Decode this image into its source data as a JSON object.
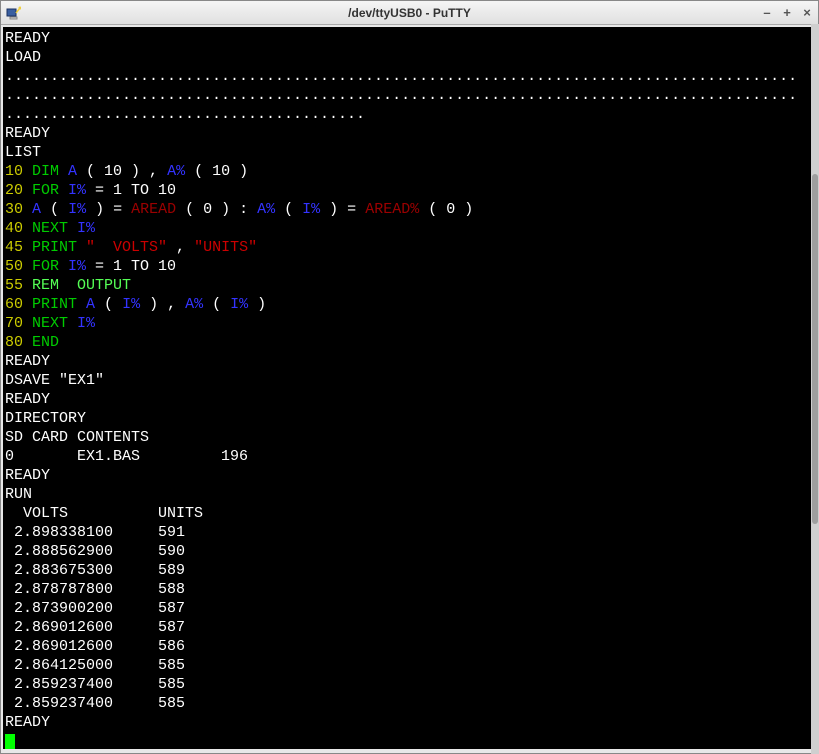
{
  "titlebar": {
    "title": "/dev/ttyUSB0 - PuTTY",
    "minimize": "–",
    "maximize": "+",
    "close": "×"
  },
  "terminal": {
    "ready1": "READY",
    "load": "LOAD",
    "dots1": "........................................................................................",
    "dots2": "........................................................................................",
    "dots3": "........................................",
    "blank": " ",
    "ready2": "READY",
    "list": "LIST",
    "l10_num": "10",
    "l10_dim": " DIM ",
    "l10_A": "A",
    "l10_p1": " ( 10 ) , ",
    "l10_Apct": "A%",
    "l10_p2": " ( 10 )",
    "l20_num": "20",
    "l20_for": " FOR ",
    "l20_Ipct": "I%",
    "l20_rest": " = 1 TO 10",
    "l30_num": "30",
    "l30_sp": " ",
    "l30_A": "A",
    "l30_p1": " ( ",
    "l30_Ipct1": "I%",
    "l30_p2": " ) = ",
    "l30_aread": "AREAD",
    "l30_p3": " ( 0 ) : ",
    "l30_Apct": "A%",
    "l30_p4": " ( ",
    "l30_Ipct2": "I%",
    "l30_p5": " ) = ",
    "l30_areadpct": "AREAD%",
    "l30_p6": " ( 0 )",
    "l40_num": "40",
    "l40_next": " NEXT ",
    "l40_Ipct": "I%",
    "l45_num": "45",
    "l45_print": " PRINT ",
    "l45_volts": "\"  VOLTS\"",
    "l45_comma": " , ",
    "l45_units": "\"UNITS\"",
    "l50_num": "50",
    "l50_for": " FOR ",
    "l50_Ipct": "I%",
    "l50_rest": " = 1 TO 10",
    "l55_num": "55",
    "l55_rem": " REM  OUTPUT",
    "l60_num": "60",
    "l60_print": " PRINT ",
    "l60_A": "A",
    "l60_p1": " ( ",
    "l60_Ipct1": "I%",
    "l60_p2": " ) , ",
    "l60_Apct": "A%",
    "l60_p3": " ( ",
    "l60_Ipct2": "I%",
    "l60_p4": " )",
    "l70_num": "70",
    "l70_next": " NEXT ",
    "l70_Ipct": "I%",
    "l80_num": "80",
    "l80_end": " END",
    "ready3": "READY",
    "dsave": "DSAVE \"EX1\"",
    "ready4": "READY",
    "directory": "DIRECTORY",
    "sdcard": "SD CARD CONTENTS",
    "dirline": "0       EX1.BAS         196",
    "ready5": "READY",
    "run": "RUN",
    "hdr": "  VOLTS          UNITS",
    "d0": " 2.898338100     591",
    "d1": " 2.888562900     590",
    "d2": " 2.883675300     589",
    "d3": " 2.878787800     588",
    "d4": " 2.873900200     587",
    "d5": " 2.869012600     587",
    "d6": " 2.869012600     586",
    "d7": " 2.864125000     585",
    "d8": " 2.859237400     585",
    "d9": " 2.859237400     585",
    "ready6": "READY"
  }
}
